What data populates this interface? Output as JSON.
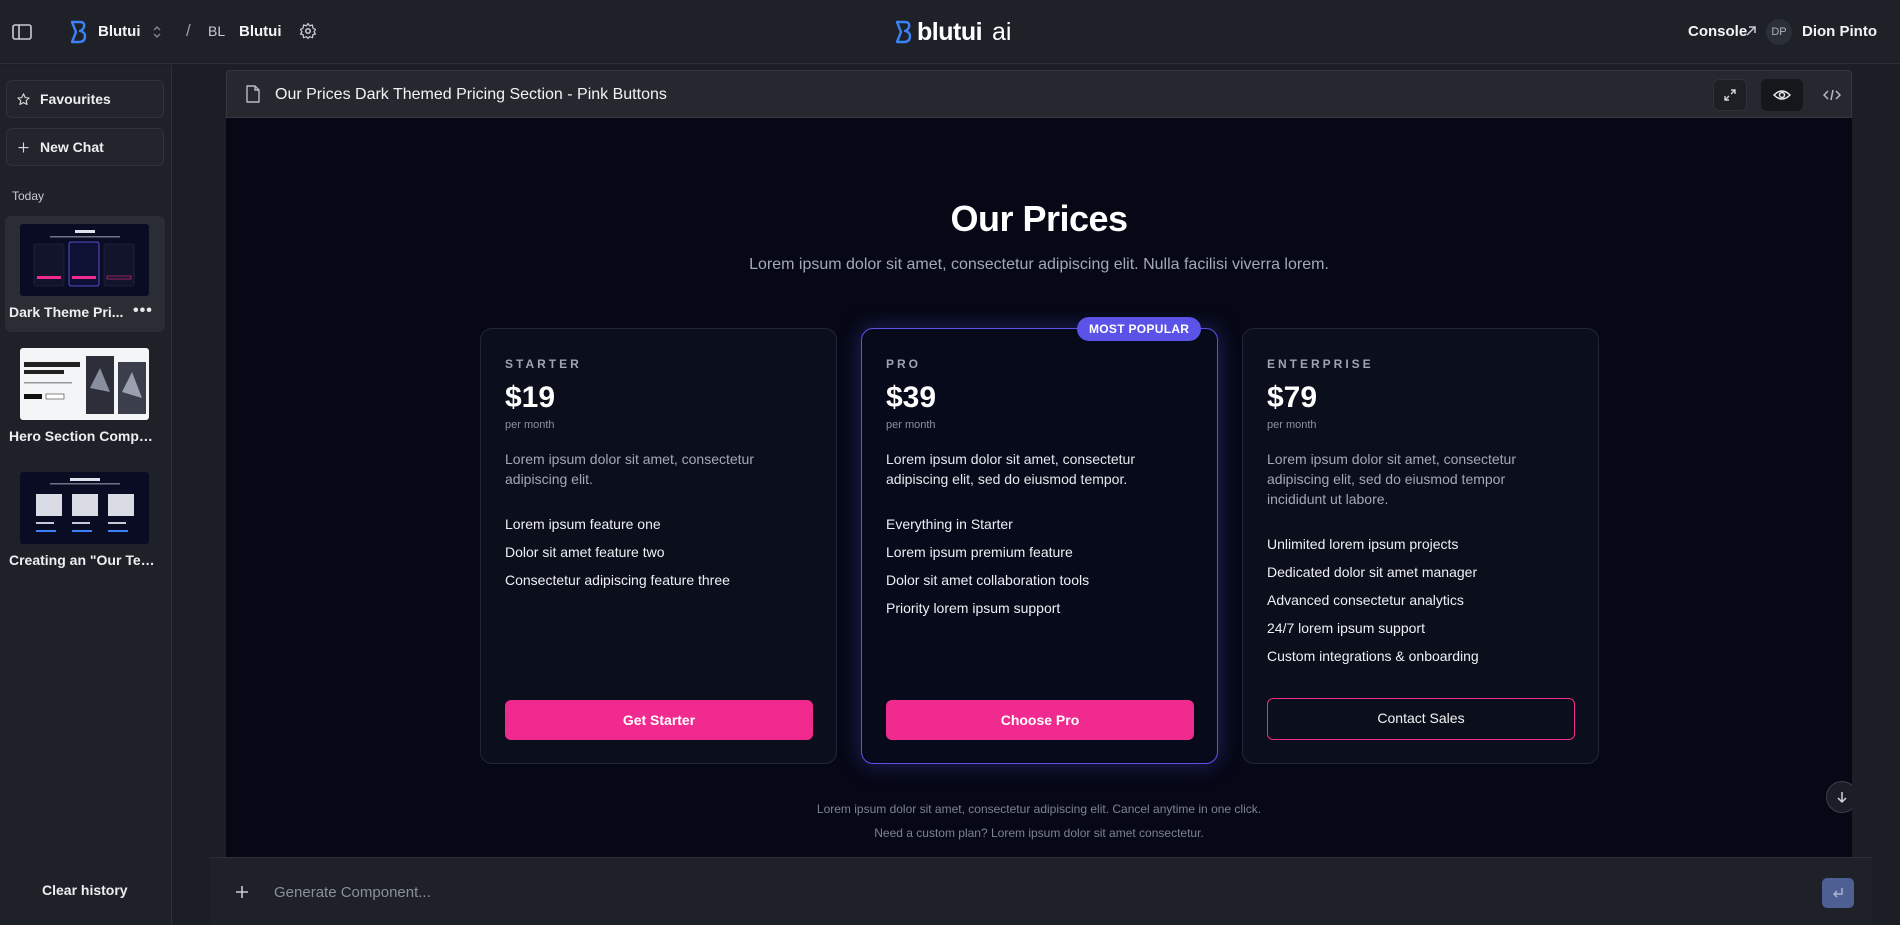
{
  "topbar": {
    "workspace_name": "Blutui",
    "slash": "/",
    "project_badge": "BL",
    "project_name": "Blutui",
    "brand_word": "blutui",
    "brand_ai": "ai",
    "console_label": "Console",
    "user_initials": "DP",
    "user_name": "Dion Pinto"
  },
  "sidebar": {
    "favourites_label": "Favourites",
    "new_chat_label": "New Chat",
    "section_label": "Today",
    "history": [
      {
        "label": "Dark Theme Pri...",
        "active": true
      },
      {
        "label": "Hero Section Compo...",
        "active": false
      },
      {
        "label": "Creating an \"Our Tea...",
        "active": false
      }
    ],
    "more_label": "•••",
    "clear_history_label": "Clear history"
  },
  "preview_header": {
    "title": "Our Prices Dark Themed Pricing Section - Pink Buttons"
  },
  "preview": {
    "title": "Our Prices",
    "subtitle": "Lorem ipsum dolor sit amet, consectetur adipiscing elit. Nulla facilisi viverra lorem.",
    "plans": [
      {
        "tier": "STARTER",
        "price": "$19",
        "period": "per month",
        "description": "Lorem ipsum dolor sit amet, consectetur adipiscing elit.",
        "features": [
          "Lorem ipsum feature one",
          "Dolor sit amet feature two",
          "Consectetur adipiscing feature three"
        ],
        "cta": "Get Starter"
      },
      {
        "tier": "PRO",
        "price": "$39",
        "period": "per month",
        "badge": "MOST POPULAR",
        "description": "Lorem ipsum dolor sit amet, consectetur adipiscing elit, sed do eiusmod tempor.",
        "features": [
          "Everything in Starter",
          "Lorem ipsum premium feature",
          "Dolor sit amet collaboration tools",
          "Priority lorem ipsum support"
        ],
        "cta": "Choose Pro"
      },
      {
        "tier": "ENTERPRISE",
        "price": "$79",
        "period": "per month",
        "description": "Lorem ipsum dolor sit amet, consectetur adipiscing elit, sed do eiusmod tempor incididunt ut labore.",
        "features": [
          "Unlimited lorem ipsum projects",
          "Dedicated dolor sit amet manager",
          "Advanced consectetur analytics",
          "24/7 lorem ipsum support",
          "Custom integrations & onboarding"
        ],
        "cta": "Contact Sales"
      }
    ],
    "footnote_1": "Lorem ipsum dolor sit amet, consectetur adipiscing elit. Cancel anytime in one click.",
    "footnote_2": "Need a custom plan? Lorem ipsum dolor sit amet consectetur."
  },
  "composer": {
    "placeholder": "Generate Component..."
  },
  "colors": {
    "accent_pink": "#f02a8f",
    "accent_indigo": "#5b52e8",
    "brand_blue": "#3b82f6"
  },
  "icons": {
    "sidebar_toggle": "sidebar-toggle-icon",
    "logo": "blutui-logo-icon",
    "settings": "gear-icon",
    "external": "arrow-up-right-icon",
    "favourites": "star-icon",
    "new_chat": "plus-icon",
    "document": "file-icon",
    "expand": "expand-icon",
    "preview": "eye-icon",
    "code": "code-icon",
    "scroll": "arrow-down-icon",
    "send": "enter-icon"
  }
}
